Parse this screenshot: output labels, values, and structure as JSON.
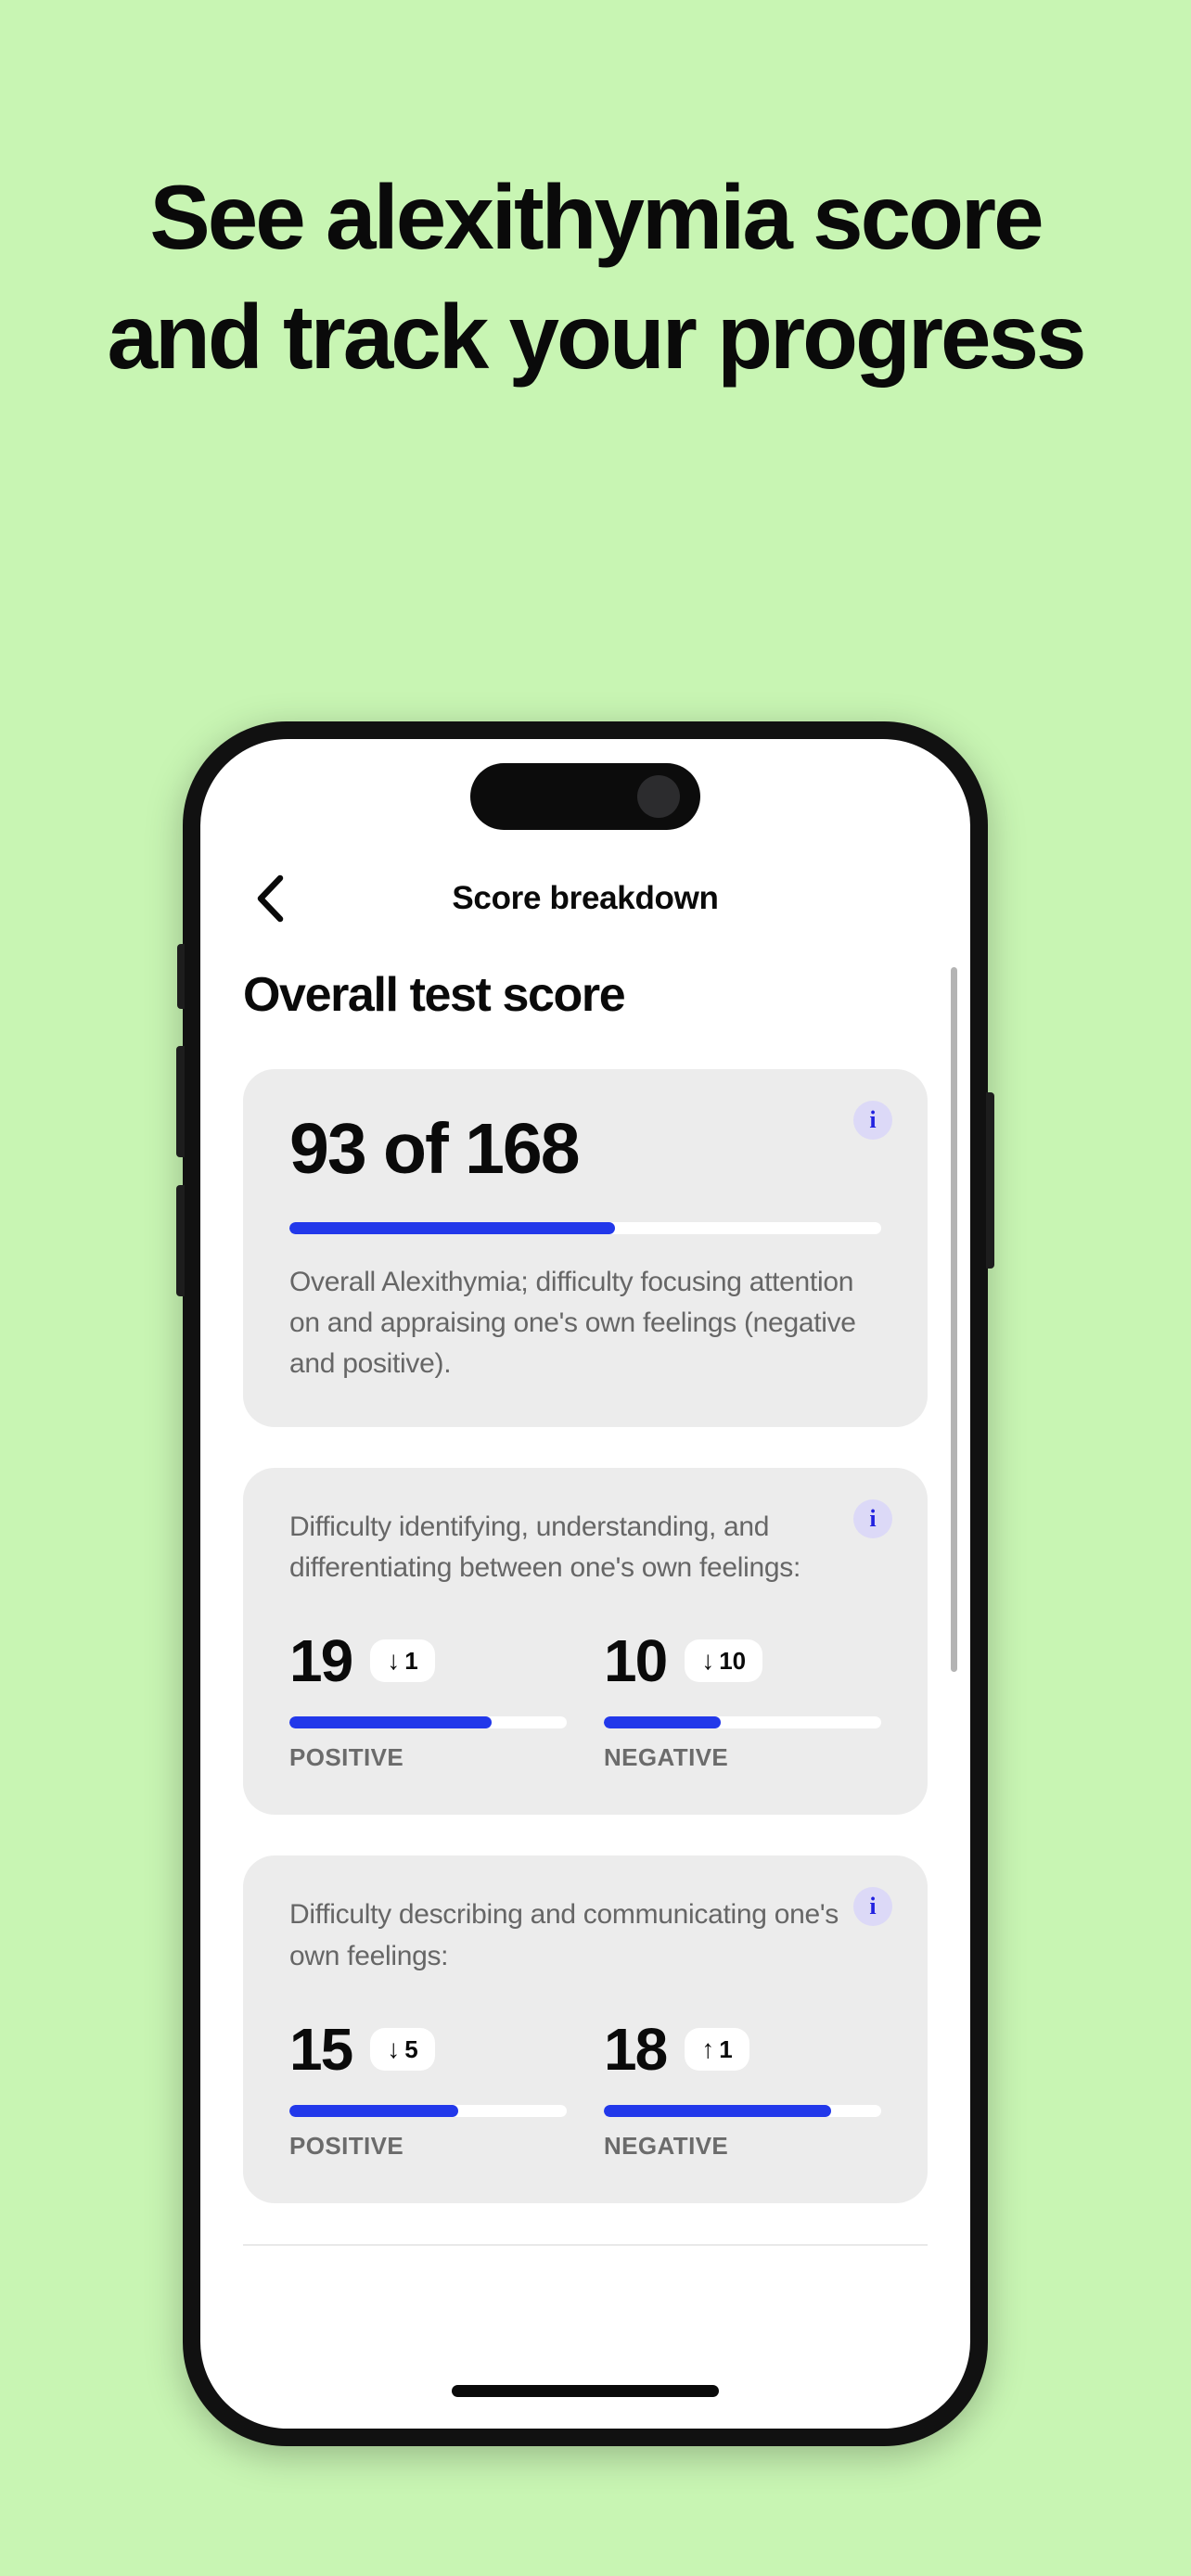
{
  "promo": {
    "headline": "See alexithymia score and track your progress",
    "background_color": "#c8f5b3"
  },
  "phone": {
    "nav": {
      "back_icon": "chevron-left-icon",
      "title": "Score breakdown"
    },
    "page_title": "Overall test score",
    "accent_color": "#2238ea",
    "info_icon_glyph": "i",
    "cards": [
      {
        "type": "overall",
        "score_text": "93 of 168",
        "progress_percent": 55,
        "description": "Overall Alexithymia; difficulty focusing attention on and appraising one's own feelings (negative and positive)."
      },
      {
        "type": "split",
        "description": "Difficulty identifying, understanding, and differentiating between one's own feelings:",
        "metrics": [
          {
            "value": "19",
            "delta_arrow": "↓",
            "delta_value": "1",
            "progress_percent": 73,
            "label": "POSITIVE"
          },
          {
            "value": "10",
            "delta_arrow": "↓",
            "delta_value": "10",
            "progress_percent": 42,
            "label": "NEGATIVE"
          }
        ]
      },
      {
        "type": "split",
        "description": "Difficulty describing and communicating one's own feelings:",
        "metrics": [
          {
            "value": "15",
            "delta_arrow": "↓",
            "delta_value": "5",
            "progress_percent": 61,
            "label": "POSITIVE"
          },
          {
            "value": "18",
            "delta_arrow": "↑",
            "delta_value": "1",
            "progress_percent": 82,
            "label": "NEGATIVE"
          }
        ]
      }
    ]
  }
}
